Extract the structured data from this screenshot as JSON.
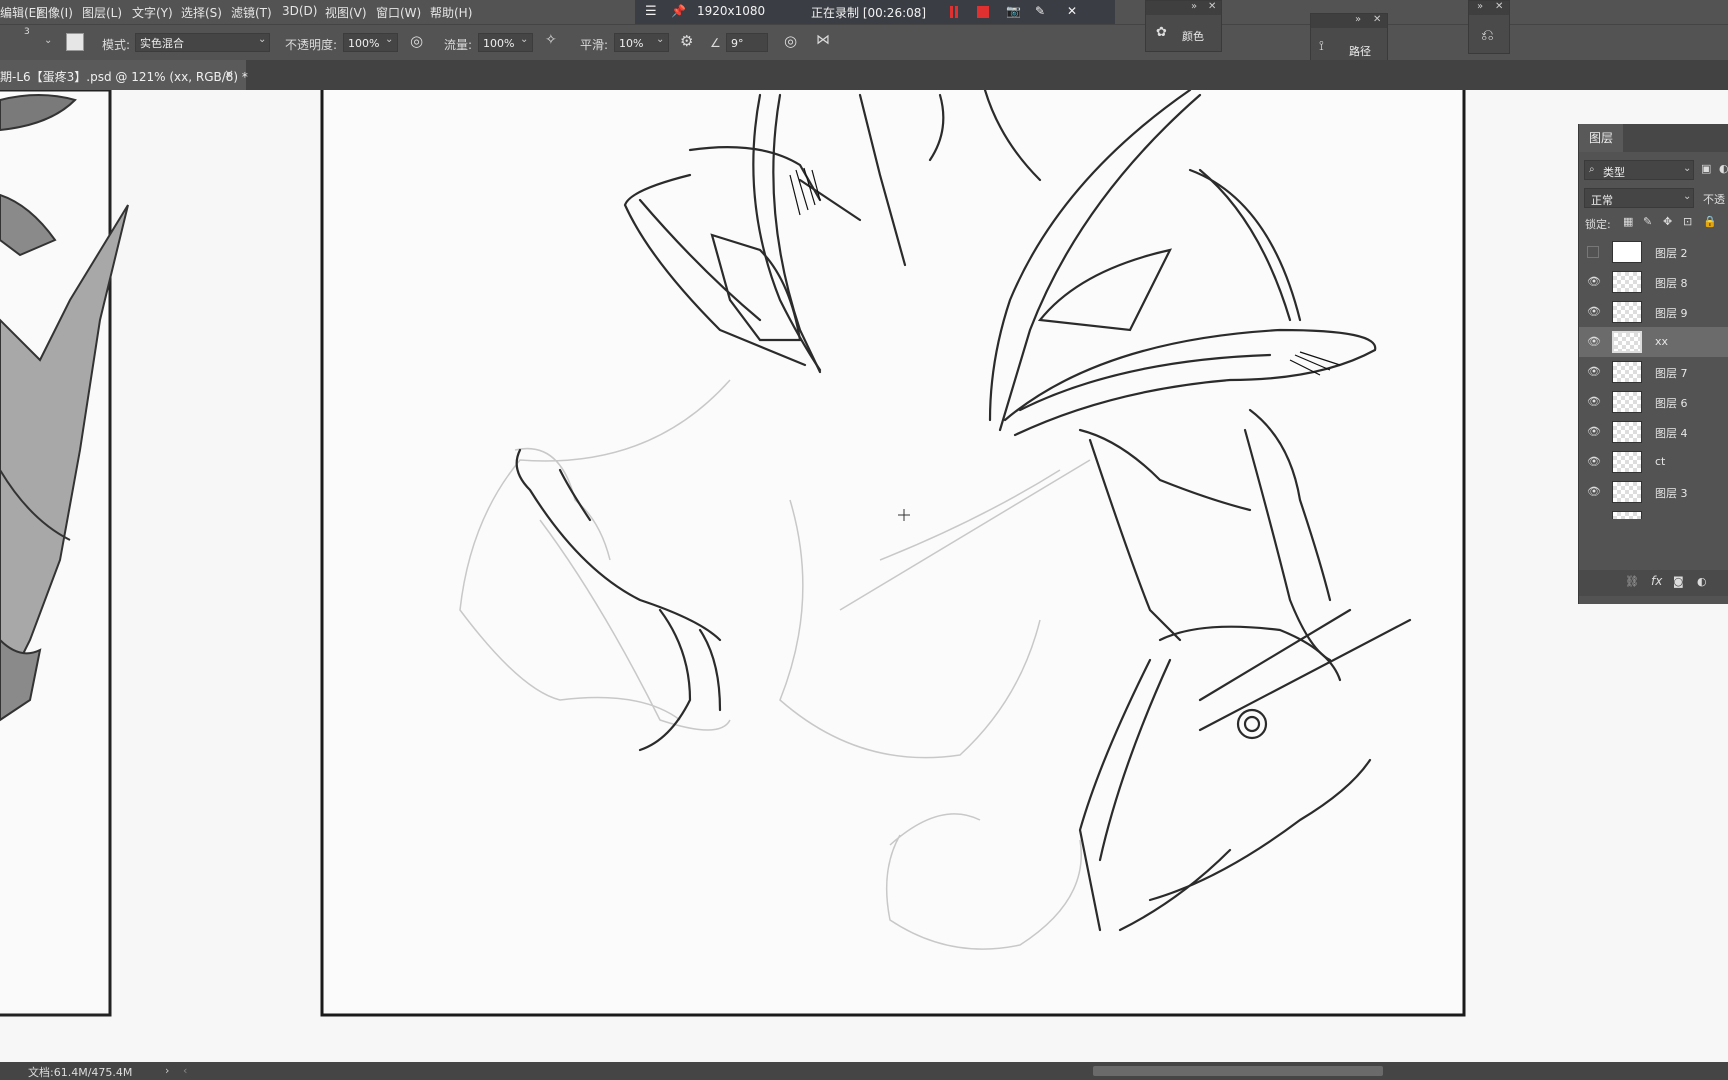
{
  "menu": {
    "items": [
      "编辑(E)",
      "图像(I)",
      "图层(L)",
      "文字(Y)",
      "选择(S)",
      "滤镜(T)",
      "3D(D)",
      "视图(V)",
      "窗口(W)",
      "帮助(H)"
    ]
  },
  "recorder": {
    "resolution": "1920x1080",
    "status": "正在录制 [00:26:08]"
  },
  "options": {
    "brush_size": "3",
    "mode_label": "模式:",
    "mode_value": "实色混合",
    "opacity_label": "不透明度:",
    "opacity_value": "100%",
    "flow_label": "流量:",
    "flow_value": "100%",
    "smoothing_label": "平滑:",
    "smoothing_value": "10%",
    "angle_value": "9°"
  },
  "panels": {
    "color_label": "颜色",
    "paths_label": "路径"
  },
  "document": {
    "tab_title": "期-L6【蛋疼3】.psd @ 121% (xx, RGB/8) *",
    "close_glyph": "×"
  },
  "layers_panel": {
    "tab_label": "图层",
    "filter_value": "类型",
    "blend_value": "正常",
    "opacity_label_partial": "不透",
    "lock_label": "锁定:",
    "layers": [
      {
        "name": "图层 2",
        "visible": false,
        "selected": false
      },
      {
        "name": "图层 8",
        "visible": true,
        "selected": false
      },
      {
        "name": "图层 9",
        "visible": true,
        "selected": false
      },
      {
        "name": "xx",
        "visible": true,
        "selected": true
      },
      {
        "name": "图层 7",
        "visible": true,
        "selected": false
      },
      {
        "name": "图层 6",
        "visible": true,
        "selected": false
      },
      {
        "name": "图层 4",
        "visible": true,
        "selected": false
      },
      {
        "name": "ct",
        "visible": true,
        "selected": false
      },
      {
        "name": "图层 3",
        "visible": true,
        "selected": false
      }
    ],
    "footer_fx": "fx"
  },
  "status": {
    "doc_info": "文档:61.4M/475.4M"
  },
  "colors": {
    "menubar_bg": "#535353",
    "recording_red": "#e03030",
    "panel_bg": "#535353"
  }
}
